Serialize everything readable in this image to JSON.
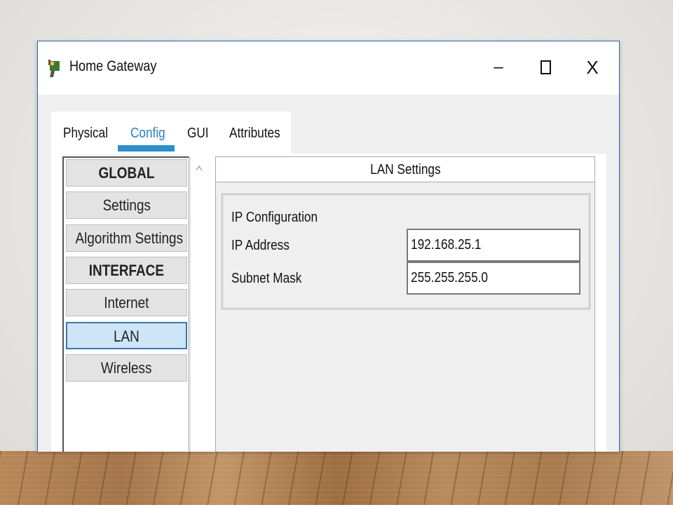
{
  "window": {
    "title": "Home Gateway",
    "minimize_glyph": "–",
    "close_glyph": "X",
    "icon": "router-app-icon"
  },
  "tabs": [
    {
      "label": "Physical",
      "active": false
    },
    {
      "label": "Config",
      "active": true
    },
    {
      "label": "GUI",
      "active": false
    },
    {
      "label": "Attributes",
      "active": false
    }
  ],
  "sidebar": {
    "items": [
      {
        "label": "GLOBAL",
        "type": "header"
      },
      {
        "label": "Settings",
        "type": "item"
      },
      {
        "label": "Algorithm Settings",
        "type": "item"
      },
      {
        "label": "INTERFACE",
        "type": "header"
      },
      {
        "label": "Internet",
        "type": "item"
      },
      {
        "label": "LAN",
        "type": "item",
        "selected": true
      },
      {
        "label": "Wireless",
        "type": "item"
      }
    ]
  },
  "content": {
    "header": "LAN Settings",
    "group_label": "IP Configuration",
    "ip_address_label": "IP Address",
    "ip_address_value": "192.168.25.1",
    "subnet_mask_label": "Subnet Mask",
    "subnet_mask_value": "255.255.255.0"
  },
  "colors": {
    "accent": "#2a8fc7",
    "selected_item": "#cde5f7",
    "window_border": "#2a62b8"
  }
}
